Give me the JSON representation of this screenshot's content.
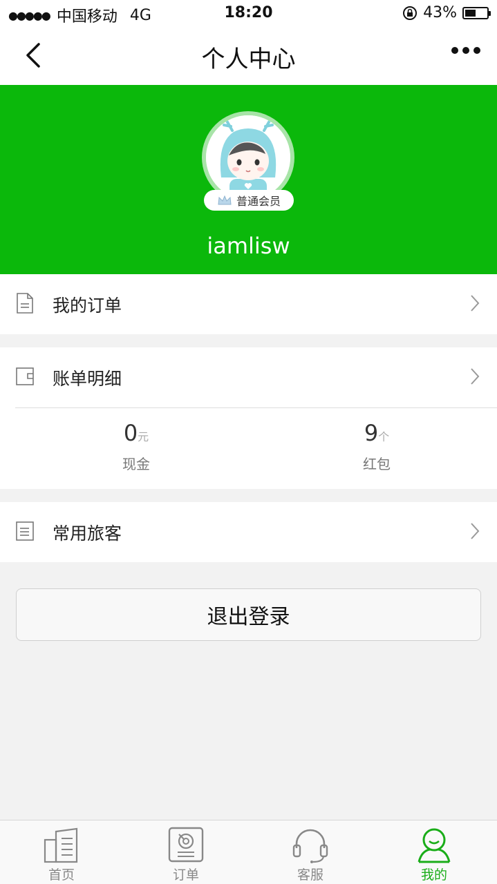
{
  "status_bar": {
    "signal": "●●●●●",
    "carrier": "中国移动",
    "network": "4G",
    "time": "18:20",
    "battery": "43%",
    "battery_level": 0.43
  },
  "nav": {
    "title": "个人中心",
    "back_icon": "chevron-left-icon",
    "more_icon": "more-dots-icon"
  },
  "profile": {
    "badge": "普通会员",
    "username": "iamlisw",
    "accent": "#0bb80b"
  },
  "menu": {
    "orders_label": "我的订单",
    "bills_label": "账单明细",
    "travelers_label": "常用旅客"
  },
  "stats": {
    "cash_value": "0",
    "cash_unit": "元",
    "cash_label": "现金",
    "redpacket_value": "9",
    "redpacket_unit": "个",
    "redpacket_label": "红包"
  },
  "logout_label": "退出登录",
  "tabbar": {
    "tabs": [
      {
        "label": "首页",
        "icon": "home-icon"
      },
      {
        "label": "订单",
        "icon": "order-icon"
      },
      {
        "label": "客服",
        "icon": "headset-icon"
      },
      {
        "label": "我的",
        "icon": "profile-icon",
        "active": true
      }
    ],
    "active_color": "#1aad19"
  }
}
